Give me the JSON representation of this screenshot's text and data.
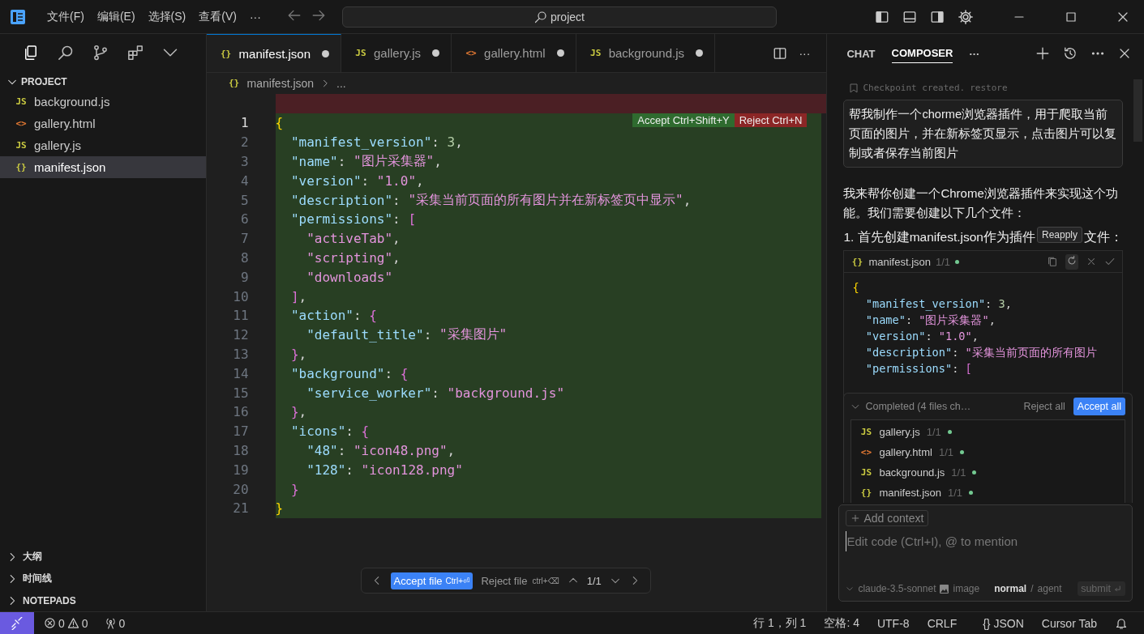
{
  "menu": {
    "items": [
      "文件(F)",
      "编辑(E)",
      "选择(S)",
      "查看(V)"
    ],
    "more": "···",
    "search": "project"
  },
  "activity": {
    "icons": [
      {
        "kind": "files",
        "selected": true
      },
      {
        "kind": "search",
        "selected": false
      },
      {
        "kind": "branch",
        "selected": false
      },
      {
        "kind": "extensions",
        "selected": false
      },
      {
        "kind": "chevron",
        "selected": false
      }
    ]
  },
  "sidebar": {
    "title": "PROJECT",
    "files": [
      {
        "icon": "JS",
        "kind": "js",
        "name": "background.js",
        "selected": false
      },
      {
        "icon": "<>",
        "kind": "html",
        "name": "gallery.html",
        "selected": false
      },
      {
        "icon": "JS",
        "kind": "js",
        "name": "gallery.js",
        "selected": false
      },
      {
        "icon": "{}",
        "kind": "json",
        "name": "manifest.json",
        "selected": true
      }
    ],
    "sections": [
      "大纲",
      "时间线",
      "NOTEPADS"
    ]
  },
  "tabs": [
    {
      "icon": "{}",
      "kind": "json",
      "label": "manifest.json",
      "selected": true,
      "modified": true
    },
    {
      "icon": "JS",
      "kind": "js",
      "label": "gallery.js",
      "selected": false,
      "modified": true
    },
    {
      "icon": "<>",
      "kind": "html",
      "label": "gallery.html",
      "selected": false,
      "modified": true
    },
    {
      "icon": "JS",
      "kind": "js",
      "label": "background.js",
      "selected": false,
      "modified": true
    }
  ],
  "tabs_more": "···",
  "breadcrumb": {
    "icon": "{}",
    "file": "manifest.json",
    "rest": "..."
  },
  "diff": {
    "accept": "Accept Ctrl+Shift+Y",
    "reject": "Reject Ctrl+N"
  },
  "code": [
    {
      "num": "1",
      "current": true,
      "tokens": [
        {
          "kind": "b1",
          "text": "{"
        }
      ]
    },
    {
      "num": "2",
      "current": false,
      "tokens": [
        {
          "kind": "k",
          "text": "  \"manifest_version\""
        },
        {
          "kind": "p",
          "text": ": "
        },
        {
          "kind": "n",
          "text": "3"
        },
        {
          "kind": "p",
          "text": ","
        }
      ]
    },
    {
      "num": "3",
      "current": false,
      "tokens": [
        {
          "kind": "k",
          "text": "  \"name\""
        },
        {
          "kind": "p",
          "text": ": "
        },
        {
          "kind": "s",
          "text": "\"图片采集器\""
        },
        {
          "kind": "p",
          "text": ","
        }
      ]
    },
    {
      "num": "4",
      "current": false,
      "tokens": [
        {
          "kind": "k",
          "text": "  \"version\""
        },
        {
          "kind": "p",
          "text": ": "
        },
        {
          "kind": "s",
          "text": "\"1.0\""
        },
        {
          "kind": "p",
          "text": ","
        }
      ]
    },
    {
      "num": "5",
      "current": false,
      "tokens": [
        {
          "kind": "k",
          "text": "  \"description\""
        },
        {
          "kind": "p",
          "text": ": "
        },
        {
          "kind": "s",
          "text": "\"采集当前页面的所有图片并在新标签页中显示\""
        },
        {
          "kind": "p",
          "text": ","
        }
      ]
    },
    {
      "num": "6",
      "current": false,
      "tokens": [
        {
          "kind": "k",
          "text": "  \"permissions\""
        },
        {
          "kind": "p",
          "text": ": "
        },
        {
          "kind": "b2",
          "text": "["
        }
      ]
    },
    {
      "num": "7",
      "current": false,
      "tokens": [
        {
          "kind": "s",
          "text": "    \"activeTab\""
        },
        {
          "kind": "p",
          "text": ","
        }
      ]
    },
    {
      "num": "8",
      "current": false,
      "tokens": [
        {
          "kind": "s",
          "text": "    \"scripting\""
        },
        {
          "kind": "p",
          "text": ","
        }
      ]
    },
    {
      "num": "9",
      "current": false,
      "tokens": [
        {
          "kind": "s",
          "text": "    \"downloads\""
        }
      ]
    },
    {
      "num": "10",
      "current": false,
      "tokens": [
        {
          "kind": "b2",
          "text": "  ]"
        },
        {
          "kind": "p",
          "text": ","
        }
      ]
    },
    {
      "num": "11",
      "current": false,
      "tokens": [
        {
          "kind": "k",
          "text": "  \"action\""
        },
        {
          "kind": "p",
          "text": ": "
        },
        {
          "kind": "b2",
          "text": "{"
        }
      ]
    },
    {
      "num": "12",
      "current": false,
      "tokens": [
        {
          "kind": "k",
          "text": "    \"default_title\""
        },
        {
          "kind": "p",
          "text": ": "
        },
        {
          "kind": "s",
          "text": "\"采集图片\""
        }
      ]
    },
    {
      "num": "13",
      "current": false,
      "tokens": [
        {
          "kind": "b2",
          "text": "  }"
        },
        {
          "kind": "p",
          "text": ","
        }
      ]
    },
    {
      "num": "14",
      "current": false,
      "tokens": [
        {
          "kind": "k",
          "text": "  \"background\""
        },
        {
          "kind": "p",
          "text": ": "
        },
        {
          "kind": "b2",
          "text": "{"
        }
      ]
    },
    {
      "num": "15",
      "current": false,
      "tokens": [
        {
          "kind": "k",
          "text": "    \"service_worker\""
        },
        {
          "kind": "p",
          "text": ": "
        },
        {
          "kind": "s",
          "text": "\"background.js\""
        }
      ]
    },
    {
      "num": "16",
      "current": false,
      "tokens": [
        {
          "kind": "b2",
          "text": "  }"
        },
        {
          "kind": "p",
          "text": ","
        }
      ]
    },
    {
      "num": "17",
      "current": false,
      "tokens": [
        {
          "kind": "k",
          "text": "  \"icons\""
        },
        {
          "kind": "p",
          "text": ": "
        },
        {
          "kind": "b2",
          "text": "{"
        }
      ]
    },
    {
      "num": "18",
      "current": false,
      "tokens": [
        {
          "kind": "k",
          "text": "    \"48\""
        },
        {
          "kind": "p",
          "text": ": "
        },
        {
          "kind": "s",
          "text": "\"icon48.png\""
        },
        {
          "kind": "p",
          "text": ","
        }
      ]
    },
    {
      "num": "19",
      "current": false,
      "tokens": [
        {
          "kind": "k",
          "text": "    \"128\""
        },
        {
          "kind": "p",
          "text": ": "
        },
        {
          "kind": "s",
          "text": "\"icon128.png\""
        }
      ]
    },
    {
      "num": "20",
      "current": false,
      "tokens": [
        {
          "kind": "b2",
          "text": "  }"
        }
      ]
    },
    {
      "num": "21",
      "current": false,
      "tokens": [
        {
          "kind": "b1",
          "text": "}"
        }
      ]
    }
  ],
  "review_bar": {
    "accept": "Accept file",
    "accept_key": "Ctrl+⏎",
    "reject": "Reject file",
    "reject_key": "ctrl+⌫",
    "count": "1/1"
  },
  "panel": {
    "tabs": [
      {
        "label": "CHAT",
        "selected": false
      },
      {
        "label": "COMPOSER",
        "selected": true
      }
    ],
    "more": "···",
    "checkpoint": "Checkpoint created.",
    "restore": "restore",
    "user_message": "帮我制作一个chorme浏览器插件，用于爬取当前页面的图片，并在新标签页显示，点击图片可以复制或者保存当前图片",
    "reply": "我来帮你创建一个Chrome浏览器插件来实现这个功能。我们需要创建以下几个文件：",
    "step_start": "1. 首先创建manifest.json作为插件",
    "step_end": "文件：",
    "tooltip": "Reapply",
    "code_block": {
      "icon": "{}",
      "file": "manifest.json",
      "count": "1/1",
      "lines": [
        [
          {
            "kind": "b1",
            "text": "{"
          }
        ],
        [
          {
            "kind": "k",
            "text": "  \"manifest_version\""
          },
          {
            "kind": "p",
            "text": ": "
          },
          {
            "kind": "n",
            "text": "3"
          },
          {
            "kind": "p",
            "text": ","
          }
        ],
        [
          {
            "kind": "k",
            "text": "  \"name\""
          },
          {
            "kind": "p",
            "text": ": "
          },
          {
            "kind": "s",
            "text": "\"图片采集器\""
          },
          {
            "kind": "p",
            "text": ","
          }
        ],
        [
          {
            "kind": "k",
            "text": "  \"version\""
          },
          {
            "kind": "p",
            "text": ": "
          },
          {
            "kind": "s",
            "text": "\"1.0\""
          },
          {
            "kind": "p",
            "text": ","
          }
        ],
        [
          {
            "kind": "k",
            "text": "  \"description\""
          },
          {
            "kind": "p",
            "text": ": "
          },
          {
            "kind": "s",
            "text": "\"采集当前页面的所有图片"
          }
        ],
        [
          {
            "kind": "k",
            "text": "  \"permissions\""
          },
          {
            "kind": "p",
            "text": ": "
          },
          {
            "kind": "b2",
            "text": "["
          }
        ]
      ]
    },
    "completed": {
      "title": "Completed (4 files ch…",
      "reject_all": "Reject all",
      "accept_all": "Accept all",
      "files": [
        {
          "icon": "JS",
          "kind": "js",
          "name": "gallery.js",
          "count": "1/1"
        },
        {
          "icon": "<>",
          "kind": "html",
          "name": "gallery.html",
          "count": "1/1"
        },
        {
          "icon": "JS",
          "kind": "js",
          "name": "background.js",
          "count": "1/1"
        },
        {
          "icon": "{}",
          "kind": "json",
          "name": "manifest.json",
          "count": "1/1"
        }
      ]
    },
    "composer": {
      "add_context": "Add context",
      "placeholder": "Edit code (Ctrl+I), @ to mention",
      "model": "claude-3.5-sonnet",
      "image": "image",
      "modes": [
        {
          "label": "normal",
          "selected": true
        },
        {
          "label": "agent",
          "selected": false
        }
      ],
      "separator": "/",
      "submit": "submit"
    }
  },
  "status": {
    "errors": "0",
    "warnings": "0",
    "ports": "0",
    "right": [
      "行 1，列 1",
      "空格: 4",
      "UTF-8",
      "CRLF"
    ],
    "lang_icon": "{}",
    "lang": "JSON",
    "tab": "Cursor Tab"
  }
}
